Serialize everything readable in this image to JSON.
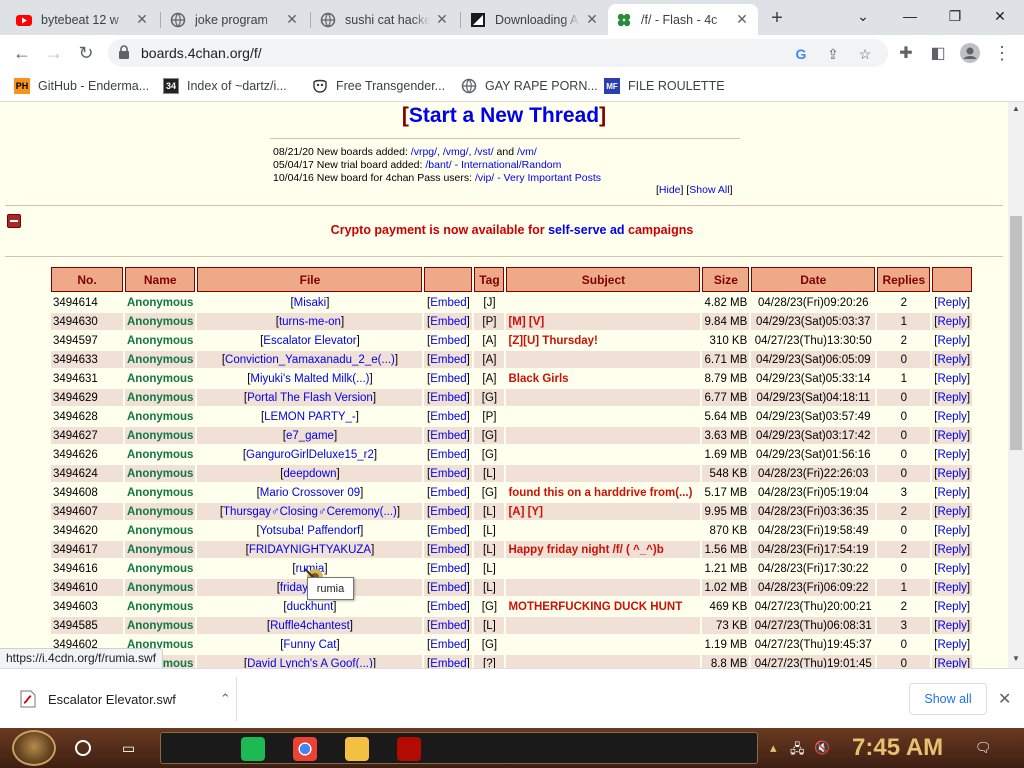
{
  "browser": {
    "tabs": [
      {
        "label": "bytebeat 12 w",
        "icon": "youtube-icon"
      },
      {
        "label": "joke program",
        "icon": "globe-icon"
      },
      {
        "label": "sushi cat hacke",
        "icon": "globe-icon"
      },
      {
        "label": "Downloading A",
        "icon": "download-page-icon"
      },
      {
        "label": "/f/ - Flash - 4c",
        "icon": "4chan-clover-icon",
        "active": true
      }
    ],
    "url": "boards.4chan.org/f/",
    "bookmarks": [
      {
        "label": "GitHub - Enderma...",
        "icon": "ph-icon",
        "icon_text": "PH"
      },
      {
        "label": "Index of ~dartz/i...",
        "icon": "index-icon",
        "icon_text": "34"
      },
      {
        "label": "Free Transgender...",
        "icon": "mask-icon",
        "icon_text": ""
      },
      {
        "label": "GAY RAPE PORN...",
        "icon": "globe-icon",
        "icon_text": ""
      },
      {
        "label": "FILE ROULETTE",
        "icon": "roulette-icon",
        "icon_text": "MF"
      }
    ]
  },
  "page": {
    "post_form": {
      "open": "[",
      "link": "Start a New Thread",
      "close": "]"
    },
    "news": [
      {
        "date": "08/21/20",
        "text": "New boards added:",
        "links": "/vrpg/, /vmg/, /vst/",
        "mid": " and ",
        "links2": "/vm/"
      },
      {
        "date": "05/04/17",
        "text": "New trial board added:",
        "links": "/bant/ - International/Random",
        "mid": "",
        "links2": ""
      },
      {
        "date": "10/04/16",
        "text": "New board for 4chan Pass users:",
        "links": "/vip/ - Very Important Posts",
        "mid": "",
        "links2": ""
      }
    ],
    "news_controls": {
      "hide": "Hide",
      "show_all": "Show All"
    },
    "ad": {
      "pre": "Crypto payment is now available for ",
      "link": "self-serve ad",
      "post": " campaigns"
    },
    "table": {
      "headers": [
        "No.",
        "Name",
        "File",
        "",
        "Tag",
        "Subject",
        "Size",
        "Date",
        "Replies",
        ""
      ],
      "embed_label": "Embed",
      "reply_label": "Reply",
      "rows": [
        {
          "no": "3494614",
          "name": "Anonymous",
          "file": "Misaki",
          "tag": "[J]",
          "subject": "",
          "size": "4.82 MB",
          "date": "04/28/23(Fri)09:20:26",
          "replies": "2"
        },
        {
          "no": "3494630",
          "name": "Anonymous",
          "file": "turns-me-on",
          "tag": "[P]",
          "subject": "[M] [V]",
          "size": "9.84 MB",
          "date": "04/29/23(Sat)05:03:37",
          "replies": "1"
        },
        {
          "no": "3494597",
          "name": "Anonymous",
          "file": "Escalator Elevator",
          "tag": "[A]",
          "subject": "[Z][U] Thursday!",
          "size": "310 KB",
          "date": "04/27/23(Thu)13:30:50",
          "replies": "2"
        },
        {
          "no": "3494633",
          "name": "Anonymous",
          "file": "Conviction_Yamaxanadu_2_e(...)",
          "tag": "[A]",
          "subject": "",
          "size": "6.71 MB",
          "date": "04/29/23(Sat)06:05:09",
          "replies": "0"
        },
        {
          "no": "3494631",
          "name": "Anonymous",
          "file": "Miyuki's Malted Milk(...)",
          "tag": "[A]",
          "subject": "Black Girls",
          "size": "8.79 MB",
          "date": "04/29/23(Sat)05:33:14",
          "replies": "1"
        },
        {
          "no": "3494629",
          "name": "Anonymous",
          "file": "Portal The Flash Version",
          "tag": "[G]",
          "subject": "",
          "size": "6.77 MB",
          "date": "04/29/23(Sat)04:18:11",
          "replies": "0"
        },
        {
          "no": "3494628",
          "name": "Anonymous",
          "file": "LEMON PARTY_-",
          "tag": "[P]",
          "subject": "",
          "size": "5.64 MB",
          "date": "04/29/23(Sat)03:57:49",
          "replies": "0"
        },
        {
          "no": "3494627",
          "name": "Anonymous",
          "file": "e7_game",
          "tag": "[G]",
          "subject": "",
          "size": "3.63 MB",
          "date": "04/29/23(Sat)03:17:42",
          "replies": "0"
        },
        {
          "no": "3494626",
          "name": "Anonymous",
          "file": "GanguroGirlDeluxe15_r2",
          "tag": "[G]",
          "subject": "",
          "size": "1.69 MB",
          "date": "04/29/23(Sat)01:56:16",
          "replies": "0"
        },
        {
          "no": "3494624",
          "name": "Anonymous",
          "file": "deepdown",
          "tag": "[L]",
          "subject": "",
          "size": "548 KB",
          "date": "04/28/23(Fri)22:26:03",
          "replies": "0"
        },
        {
          "no": "3494608",
          "name": "Anonymous",
          "file": "Mario Crossover 09",
          "tag": "[G]",
          "subject": "found this on a harddrive from(...)",
          "size": "5.17 MB",
          "date": "04/28/23(Fri)05:19:04",
          "replies": "3"
        },
        {
          "no": "3494607",
          "name": "Anonymous",
          "file": "Thursgay♂Closing♂Ceremony(...)",
          "tag": "[L]",
          "subject": "[A] [Y]",
          "size": "9.95 MB",
          "date": "04/28/23(Fri)03:36:35",
          "replies": "2"
        },
        {
          "no": "3494620",
          "name": "Anonymous",
          "file": "Yotsuba! Paffendorf",
          "tag": "[L]",
          "subject": "",
          "size": "870 KB",
          "date": "04/28/23(Fri)19:58:49",
          "replies": "0"
        },
        {
          "no": "3494617",
          "name": "Anonymous",
          "file": "FRIDAYNIGHTYAKUZA",
          "tag": "[L]",
          "subject": "Happy friday night /f/ ( ^_^)b",
          "size": "1.56 MB",
          "date": "04/28/23(Fri)17:54:19",
          "replies": "2"
        },
        {
          "no": "3494616",
          "name": "Anonymous",
          "file": "rumia",
          "tag": "[L]",
          "subject": "",
          "size": "1.21 MB",
          "date": "04/28/23(Fri)17:30:22",
          "replies": "0"
        },
        {
          "no": "3494610",
          "name": "Anonymous",
          "file": "friday_at_...",
          "tag": "[L]",
          "subject": "",
          "size": "1.02 MB",
          "date": "04/28/23(Fri)06:09:22",
          "replies": "1"
        },
        {
          "no": "3494603",
          "name": "Anonymous",
          "file": "duckhunt",
          "tag": "[G]",
          "subject": "MOTHERFUCKING DUCK HUNT",
          "size": "469 KB",
          "date": "04/27/23(Thu)20:00:21",
          "replies": "2"
        },
        {
          "no": "3494585",
          "name": "Anonymous",
          "file": "Ruffle4chantest",
          "tag": "[L]",
          "subject": "",
          "size": "73 KB",
          "date": "04/27/23(Thu)06:08:31",
          "replies": "3"
        },
        {
          "no": "3494602",
          "name": "Anonymous",
          "file": "Funny Cat",
          "tag": "[G]",
          "subject": "",
          "size": "1.19 MB",
          "date": "04/27/23(Thu)19:45:37",
          "replies": "0"
        },
        {
          "no": "3494601",
          "name": "Anonymous",
          "file": "David Lynch's A Goof(...)",
          "tag": "[?]",
          "subject": "",
          "size": "8.8 MB",
          "date": "04/27/23(Thu)19:01:45",
          "replies": "0"
        }
      ]
    },
    "tooltip": "rumia",
    "status_url": "https://i.4cdn.org/f/rumia.swf"
  },
  "downloads": {
    "file": "Escalator Elevator.swf",
    "show_all": "Show all"
  },
  "taskbar": {
    "time": "7:45 AM"
  },
  "colors": {
    "tab_strip": "#dee1e6",
    "page_bg": "#ffffee",
    "header_bg": "#eeaa88",
    "name_green": "#117743",
    "subject_red": "#cc1105",
    "link_blue": "#0000ee",
    "clock_gold": "#e8c070"
  }
}
